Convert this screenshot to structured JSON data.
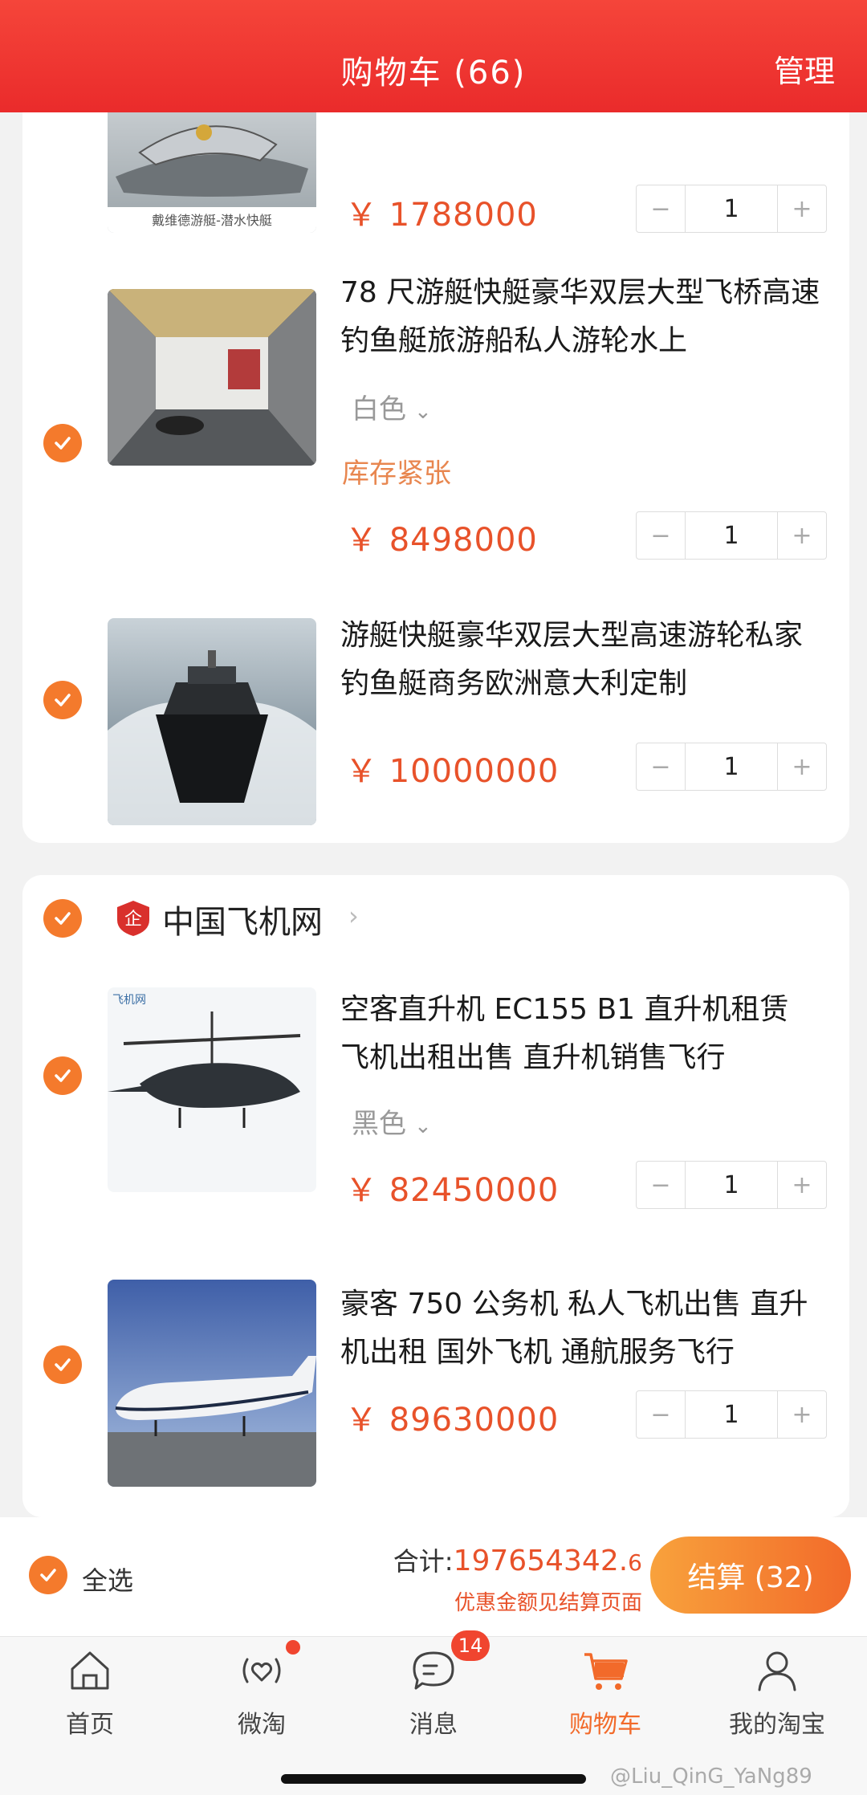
{
  "header": {
    "title": "购物车 (66)",
    "manage": "管理"
  },
  "store1": {
    "items": [
      {
        "thumb_caption": "戴维德游艇-潜水快艇",
        "price": "￥ 1788000",
        "qty": "1"
      },
      {
        "title": "78 尺游艇快艇豪华双层大型飞桥高速钓鱼艇旅游船私人游轮水上",
        "spec": "白色",
        "stock": "库存紧张",
        "price": "￥ 8498000",
        "qty": "1"
      },
      {
        "title": "游艇快艇豪华双层大型高速游轮私家钓鱼艇商务欧洲意大利定制",
        "price": "￥ 10000000",
        "qty": "1"
      }
    ]
  },
  "store2": {
    "name": "中国飞机网",
    "badge": "企",
    "items": [
      {
        "title": "空客直升机 EC155 B1 直升机租赁 飞机出租出售 直升机销售飞行",
        "spec": "黑色",
        "price": "￥ 82450000",
        "qty": "1"
      },
      {
        "title": "豪客 750 公务机 私人飞机出售 直升机出租 国外飞机 通航服务飞行",
        "price": "￥ 89630000",
        "qty": "1"
      }
    ]
  },
  "stepper": {
    "minus": "−",
    "plus": "+"
  },
  "footer": {
    "select_all": "全选",
    "total_label": "合计:",
    "total_amount": "197654342.",
    "total_decimal": "6",
    "discount_note": "优惠金额见结算页面",
    "checkout": "结算 (32)"
  },
  "tabs": [
    {
      "label": "首页",
      "icon": "home-icon"
    },
    {
      "label": "微淘",
      "icon": "weitao-icon"
    },
    {
      "label": "消息",
      "icon": "message-icon",
      "badge": "14"
    },
    {
      "label": "购物车",
      "icon": "cart-icon",
      "active": true
    },
    {
      "label": "我的淘宝",
      "icon": "profile-icon"
    }
  ],
  "watermark": "@Liu_QinG_YaNg89",
  "colors": {
    "header": "#f0352f",
    "accent": "#f47a2c",
    "price": "#e8522a",
    "stock": "#e8864f"
  }
}
